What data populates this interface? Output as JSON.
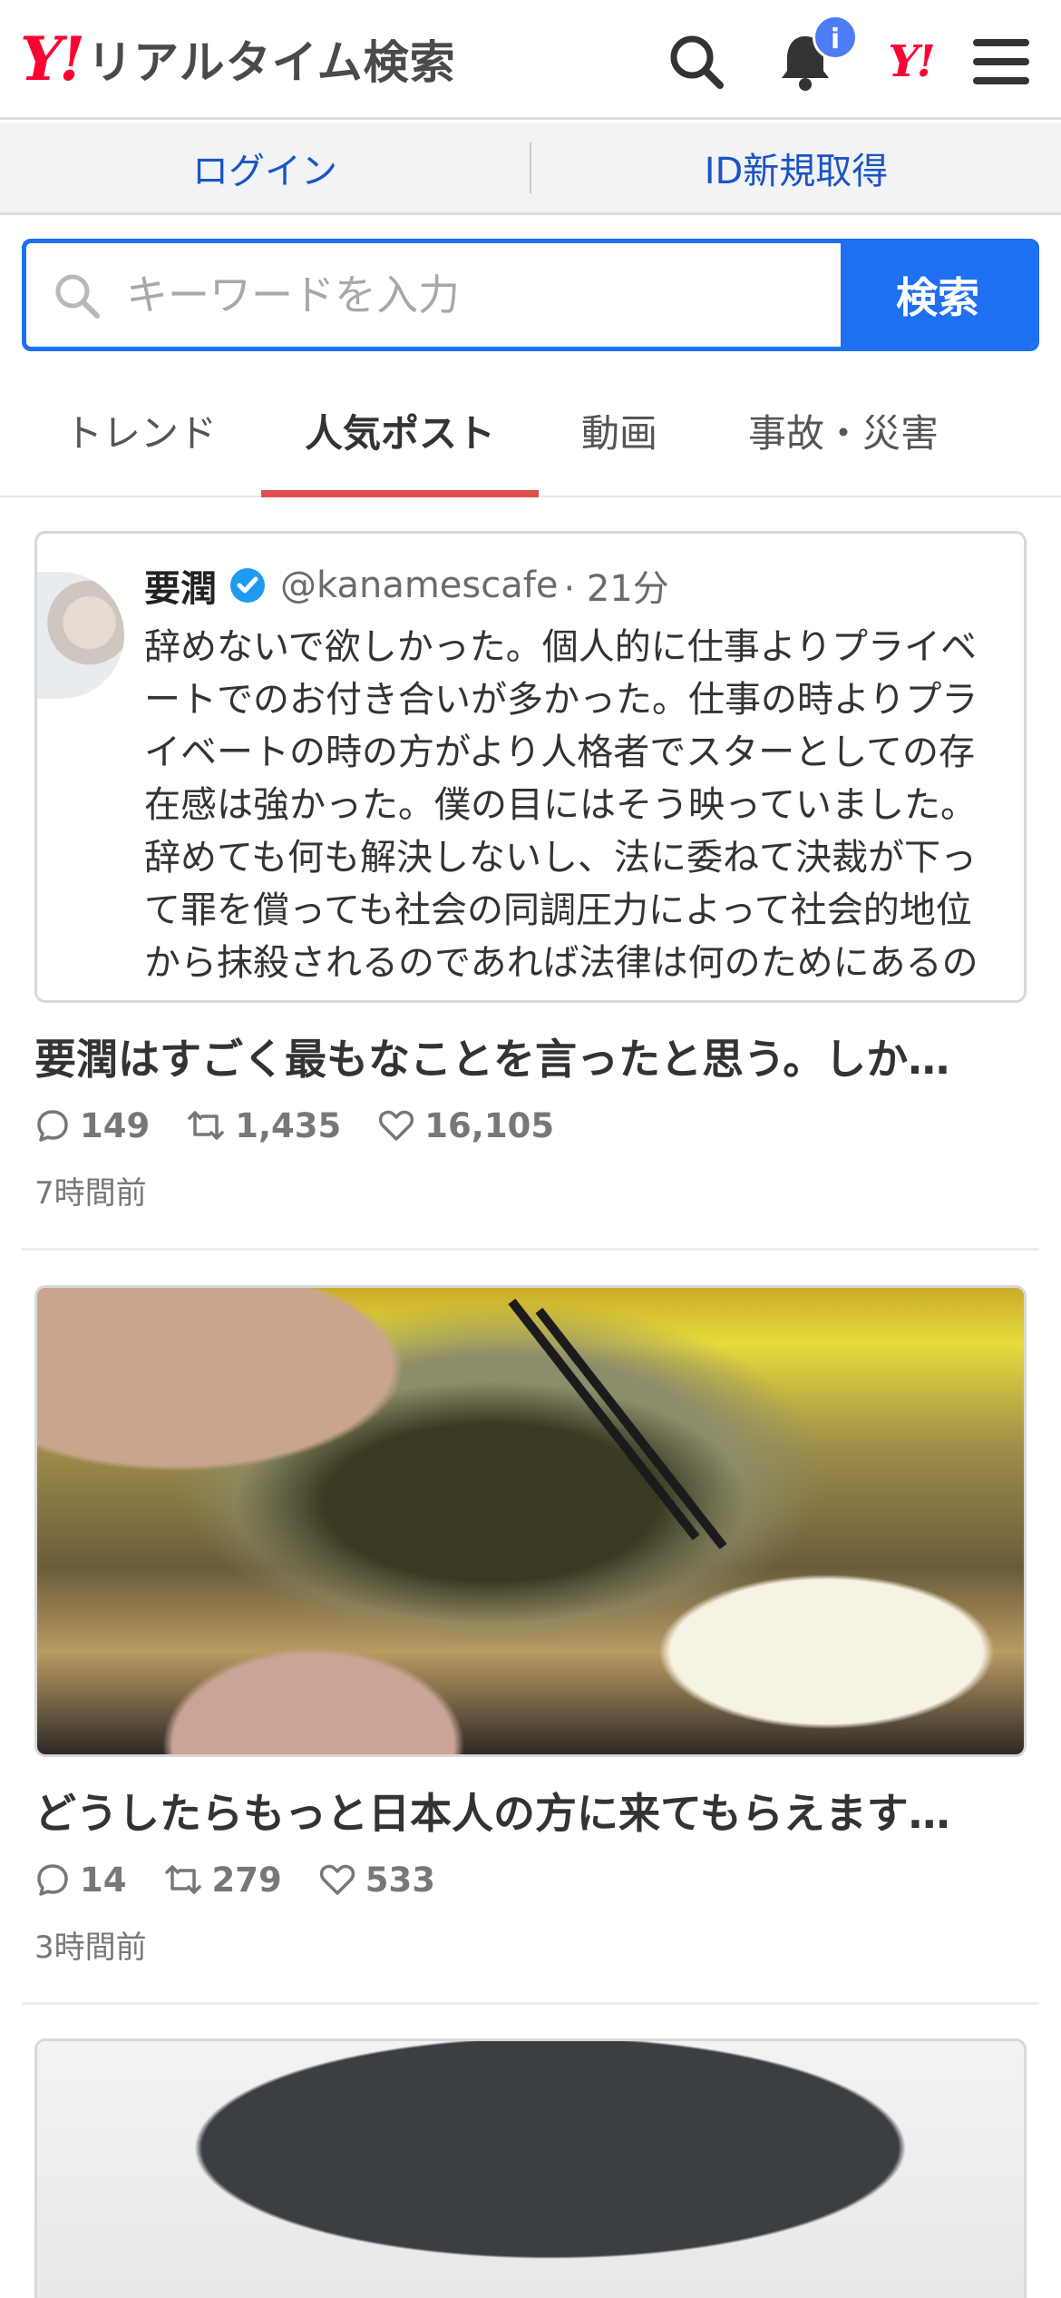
{
  "header": {
    "logo_mark": "Y!",
    "logo_text": "リアルタイム検索",
    "notification_badge": "i",
    "yahoo_mark": "Y!",
    "accent_color": "#ff0033"
  },
  "login_bar": {
    "login_label": "ログイン",
    "signup_label": "ID新規取得"
  },
  "search": {
    "placeholder": "キーワードを入力",
    "button_label": "検索",
    "accent_color": "#1f6ff2"
  },
  "tabs": [
    {
      "label": "トレンド",
      "active": false
    },
    {
      "label": "人気ポスト",
      "active": true
    },
    {
      "label": "動画",
      "active": false
    },
    {
      "label": "事故・災害",
      "active": false
    }
  ],
  "posts": [
    {
      "embedded_tweet": {
        "name": "要潤",
        "handle": "@kanamescafe",
        "age": "· 21分",
        "lines": [
          "辞めないで欲しかった。個人的に仕事よりプライベ",
          "ートでのお付き合いが多かった。仕事の時よりプラ",
          "イベートの時の方がより人格者でスターとしての存",
          "在感は強かった。僕の目にはそう映っていました。",
          "辞めても何も解決しないし、法に委ねて決裁が下っ",
          "て罪を償っても社会の同調圧力によって社会的地位",
          "から抹殺されるのであれば法律は何のためにあるの"
        ]
      },
      "title": "要潤はすごく最もなことを言ったと思う。しか…",
      "replies": "149",
      "reposts": "1,435",
      "likes": "16,105",
      "time": "7時間前"
    },
    {
      "title": "どうしたらもっと日本人の方に来てもらえます…",
      "replies": "14",
      "reposts": "279",
      "likes": "533",
      "time": "3時間前"
    }
  ]
}
